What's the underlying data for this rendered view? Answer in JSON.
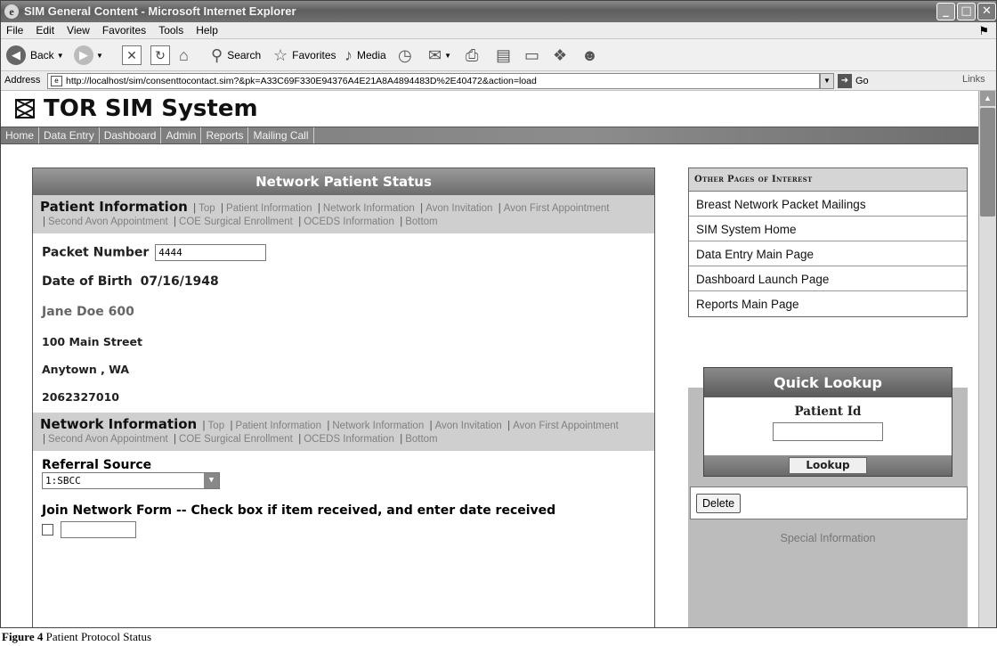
{
  "browser": {
    "title": "SIM General Content - Microsoft Internet Explorer",
    "menu": [
      "File",
      "Edit",
      "View",
      "Favorites",
      "Tools",
      "Help"
    ],
    "toolbar": {
      "back": "Back",
      "search": "Search",
      "favorites": "Favorites",
      "media": "Media"
    },
    "address_label": "Address",
    "url": "http://localhost/sim/consenttocontact.sim?&pk=A33C69F330E94376A4E21A8A4894483D%2E40472&action=load",
    "go": "Go",
    "links": "Links"
  },
  "site": {
    "title": "TOR SIM System",
    "nav": [
      "Home",
      "Data Entry",
      "Dashboard",
      "Admin",
      "Reports",
      "Mailing Call"
    ]
  },
  "main": {
    "panel_title": "Network Patient Status",
    "patient_section": {
      "heading": "Patient Information",
      "links": [
        "Top",
        "Patient Information",
        "Network Information",
        "Avon Invitation",
        "Avon First Appointment",
        "Second Avon Appointment",
        "COE Surgical Enrollment",
        "OCEDS Information",
        "Bottom"
      ]
    },
    "packet_number_label": "Packet Number",
    "packet_number_value": "4444",
    "dob_label": "Date of Birth",
    "dob_value": "07/16/1948",
    "patient_name": "Jane Doe 600",
    "address_line": "100 Main Street",
    "city_state": "Anytown , WA",
    "phone": "2062327010",
    "network_section": {
      "heading": "Network Information",
      "links": [
        "Top",
        "Patient Information",
        "Network Information",
        "Avon Invitation",
        "Avon First Appointment",
        "Second Avon Appointment",
        "COE Surgical Enrollment",
        "OCEDS Information",
        "Bottom"
      ]
    },
    "referral_label": "Referral Source",
    "referral_value": "1:SBCC",
    "join_label": "Join Network Form -- Check box if item received, and enter date received"
  },
  "sidebar": {
    "heading": "Other Pages of Interest",
    "items": [
      "Breast Network Packet Mailings",
      "SIM System Home",
      "Data Entry Main Page",
      "Dashboard Launch Page",
      "Reports Main Page"
    ],
    "quick_lookup": {
      "title": "Quick Lookup",
      "label": "Patient Id",
      "button": "Lookup"
    },
    "delete_button": "Delete",
    "special_info": "Special Information"
  },
  "caption": {
    "figure": "Figure 4",
    "text": "Patient Protocol Status"
  }
}
